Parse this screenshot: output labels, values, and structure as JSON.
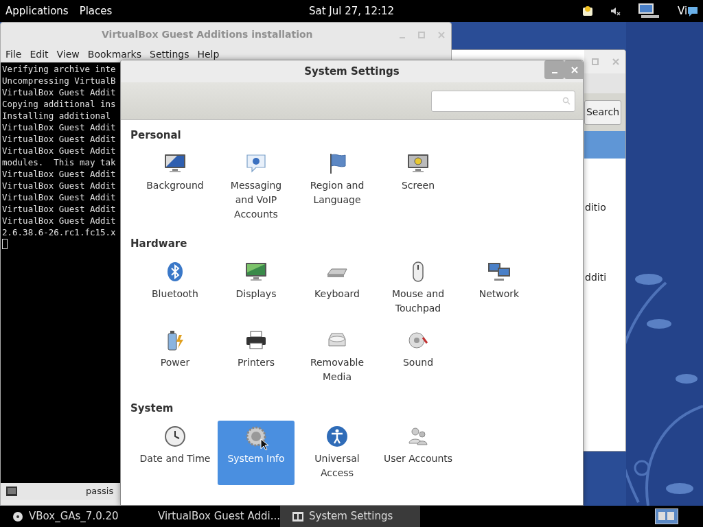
{
  "top_bar": {
    "menus": [
      "Applications",
      "Places"
    ],
    "clock": "Sat Jul 27, 12:12",
    "user": "Vi"
  },
  "terminal_window": {
    "title": "VirtualBox Guest Additions installation",
    "menu": [
      "File",
      "Edit",
      "View",
      "Bookmarks",
      "Settings",
      "Help"
    ],
    "lines": [
      "Verifying archive inte",
      "Uncompressing VirtualB",
      "VirtualBox Guest Addit",
      "Copying additional ins",
      "Installing additional",
      "VirtualBox Guest Addit",
      "VirtualBox Guest Addit",
      "VirtualBox Guest Addit",
      "modules.  This may tak",
      "VirtualBox Guest Addit",
      "VirtualBox Guest Addit",
      "VirtualBox Guest Addit",
      "VirtualBox Guest Addit",
      "VirtualBox Guest Addit",
      "2.6.38.6-26.rc1.fc15.x"
    ],
    "status_text": "passis"
  },
  "back_window": {
    "search_button": "Search",
    "rows": [
      {
        "selected": true
      },
      {
        "text": "ditio",
        "selected": false
      },
      {
        "text": "dditi",
        "selected": false
      }
    ]
  },
  "settings_window": {
    "title": "System Settings",
    "sections": [
      {
        "title": "Personal",
        "items": [
          {
            "label": "Background",
            "selected": false
          },
          {
            "label": "Messaging and VoIP Accounts",
            "selected": false
          },
          {
            "label": "Region and Language",
            "selected": false
          },
          {
            "label": "Screen",
            "selected": false
          }
        ]
      },
      {
        "title": "Hardware",
        "items": [
          {
            "label": "Bluetooth",
            "selected": false
          },
          {
            "label": "Displays",
            "selected": false
          },
          {
            "label": "Keyboard",
            "selected": false
          },
          {
            "label": "Mouse and Touchpad",
            "selected": false
          },
          {
            "label": "Network",
            "selected": false
          },
          {
            "label": "Power",
            "selected": false
          },
          {
            "label": "Printers",
            "selected": false
          },
          {
            "label": "Removable Media",
            "selected": false
          },
          {
            "label": "Sound",
            "selected": false
          }
        ]
      },
      {
        "title": "System",
        "items": [
          {
            "label": "Date and Time",
            "selected": false
          },
          {
            "label": "System Info",
            "selected": true
          },
          {
            "label": "Universal Access",
            "selected": false
          },
          {
            "label": "User Accounts",
            "selected": false
          }
        ]
      }
    ]
  },
  "taskbar": {
    "items": [
      {
        "label": "VBox_GAs_7.0.20",
        "selected": false
      },
      {
        "label": "VirtualBox Guest Addi...",
        "selected": false
      },
      {
        "label": "System Settings",
        "selected": true
      }
    ]
  }
}
